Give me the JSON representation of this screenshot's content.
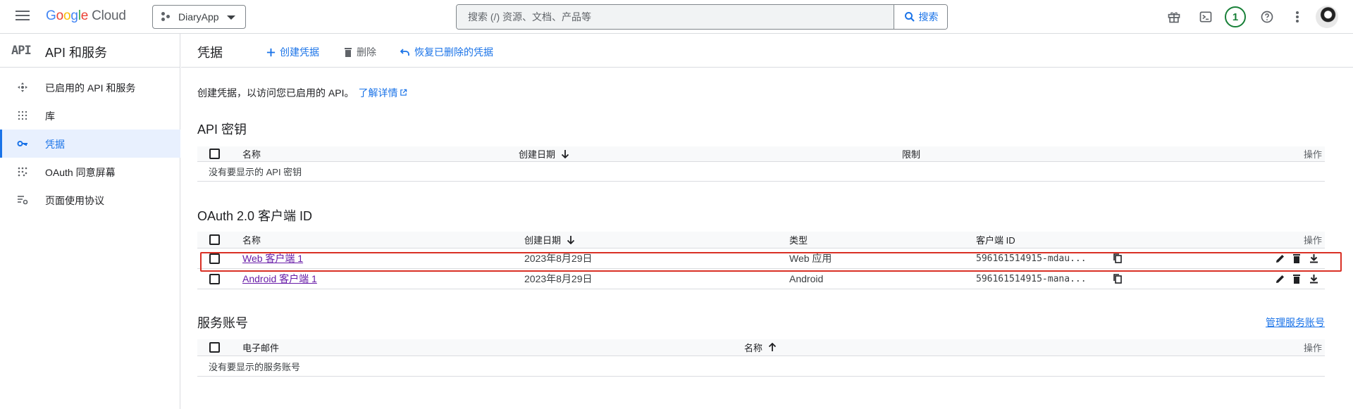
{
  "header": {
    "logo_google": "Google",
    "logo_cloud": "Cloud",
    "project": "DiaryApp",
    "search_placeholder": "搜索 (/) 资源、文档、产品等",
    "search_button": "搜索",
    "notification_count": "1"
  },
  "sidebar": {
    "logo": "API",
    "title": "API 和服务",
    "items": [
      {
        "label": "已启用的 API 和服务",
        "icon": "enabled-apis-icon"
      },
      {
        "label": "库",
        "icon": "library-icon"
      },
      {
        "label": "凭据",
        "icon": "key-icon"
      },
      {
        "label": "OAuth 同意屏幕",
        "icon": "oauth-consent-icon"
      },
      {
        "label": "页面使用协议",
        "icon": "page-usage-icon"
      }
    ],
    "active_index": 2
  },
  "page": {
    "title": "凭据",
    "actions": {
      "create": "创建凭据",
      "delete": "删除",
      "restore": "恢复已删除的凭据"
    },
    "intro_text": "创建凭据，以访问您已启用的 API。",
    "learn_more": "了解详情"
  },
  "api_keys": {
    "title": "API 密钥",
    "columns": {
      "name": "名称",
      "created": "创建日期",
      "restrictions": "限制",
      "actions": "操作"
    },
    "empty_text": "没有要显示的 API 密钥"
  },
  "oauth": {
    "title": "OAuth 2.0 客户端 ID",
    "columns": {
      "name": "名称",
      "created": "创建日期",
      "type": "类型",
      "client_id": "客户端 ID",
      "actions": "操作"
    },
    "rows": [
      {
        "name": "Web 客户端 1",
        "created": "2023年8月29日",
        "type": "Web 应用",
        "client_id": "596161514915-mdau..."
      },
      {
        "name": "Android 客户端 1",
        "created": "2023年8月29日",
        "type": "Android",
        "client_id": "596161514915-mana..."
      }
    ]
  },
  "service_accounts": {
    "title": "服务账号",
    "manage_link": "管理服务账号",
    "columns": {
      "email": "电子邮件",
      "name": "名称",
      "actions": "操作"
    },
    "empty_text": "没有要显示的服务账号"
  },
  "colors": {
    "accent": "#1a73e8",
    "link_visited": "#681da8",
    "highlight": "#d93025",
    "success": "#188038"
  }
}
